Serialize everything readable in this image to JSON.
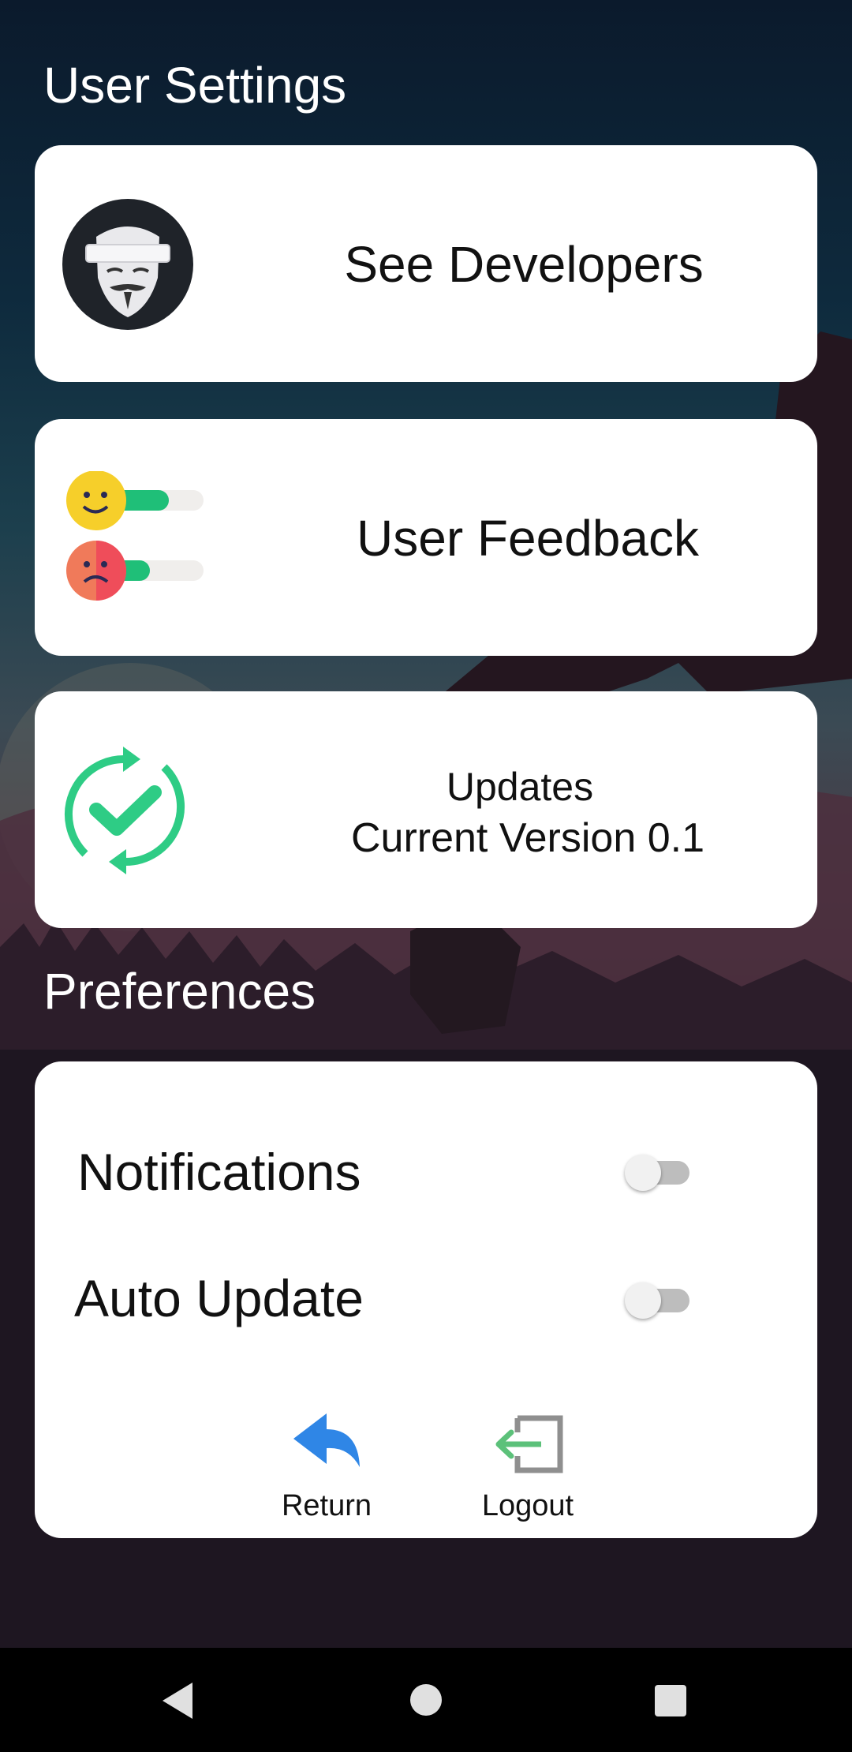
{
  "header": {
    "title": "User Settings"
  },
  "cards": [
    {
      "label": "See Developers",
      "icon": "anonymous-mask-avatar"
    },
    {
      "label": "User Feedback",
      "icon": "feedback-sliders-icon"
    },
    {
      "label_line1": "Updates",
      "label_line2": "Current Version 0.1",
      "icon": "refresh-check-icon"
    }
  ],
  "preferences": {
    "title": "Preferences",
    "items": [
      {
        "label": "Notifications",
        "enabled": false
      },
      {
        "label": "Auto Update",
        "enabled": false
      }
    ]
  },
  "actions": {
    "return_label": "Return",
    "logout_label": "Logout"
  },
  "colors": {
    "accent_green": "#2ecc85",
    "return_blue": "#2f86e6",
    "logout_green": "#5cc17a"
  },
  "navbar": {
    "buttons": [
      "back-icon",
      "home-icon",
      "recents-icon"
    ]
  }
}
